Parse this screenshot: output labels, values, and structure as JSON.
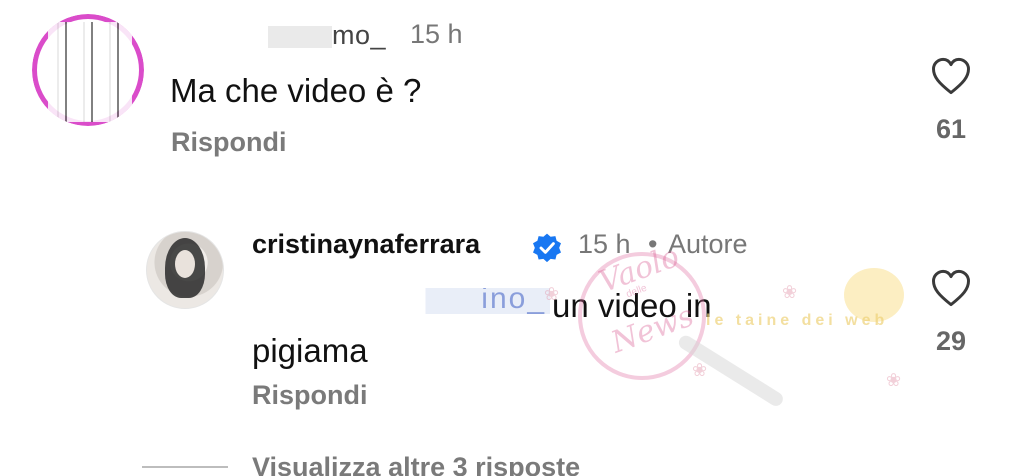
{
  "first_comment": {
    "username_visible_part": "mo_",
    "time": "15 h",
    "text": "Ma che video è ?",
    "reply_label": "Rispondi",
    "like_icon": "heart-outline-icon",
    "like_count": "61"
  },
  "reply_comment": {
    "author": "cristinaynaferrara",
    "verified_icon": "verified-badge-icon",
    "time": "15 h",
    "separator": "•",
    "author_badge": "Autore",
    "mention_visible_part": "ino_",
    "text": "un video in pigiama",
    "reply_label": "Rispondi",
    "like_icon": "heart-outline-icon",
    "like_count": "29"
  },
  "more_replies": {
    "label": "Visualizza altre 3 risposte"
  },
  "watermark": {
    "line_1": "Vaolo",
    "line_2": "delle",
    "line_3": "News",
    "banner": "le taine dei web"
  },
  "colors": {
    "background": "#ffffff",
    "text_primary": "#111111",
    "text_secondary": "#777777",
    "verified_blue": "#1877f2",
    "story_ring": "#d11fbd"
  }
}
